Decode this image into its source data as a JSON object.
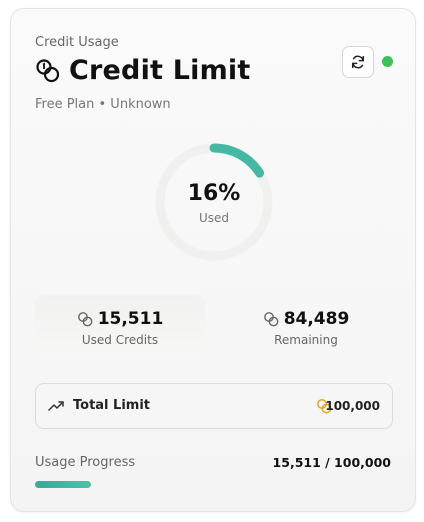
{
  "card": {
    "eyebrow": "Credit Usage",
    "title": "Credit Limit",
    "subtitle": "Free Plan • Unknown",
    "status_color": "#3ec05a",
    "accent_color": "#45b7a3"
  },
  "gauge": {
    "percent": 16,
    "percent_text": "16%",
    "label": "Used"
  },
  "stats": {
    "used": {
      "value": "15,511",
      "label": "Used Credits",
      "icon": "coins-icon"
    },
    "remaining": {
      "value": "84,489",
      "label": "Remaining",
      "icon": "coins-icon"
    }
  },
  "total": {
    "label": "Total Limit",
    "icon": "trending-up-icon",
    "value": "100,000",
    "value_icon": "coins-icon"
  },
  "progress": {
    "label": "Usage Progress",
    "value_text": "15,511 / 100,000",
    "fraction": 0.15511
  },
  "header_actions": {
    "refresh_icon": "refresh-icon"
  }
}
